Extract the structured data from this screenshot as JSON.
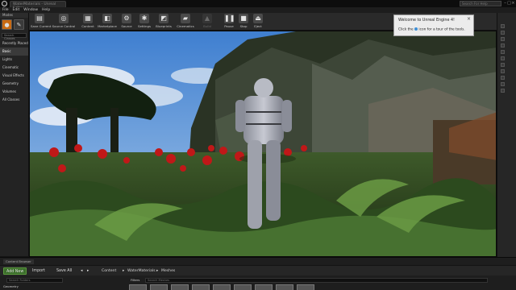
{
  "window": {
    "tab_title": "WaterMaterials - Unreal Editor",
    "search_placeholder": "Search For Help"
  },
  "menu": [
    "File",
    "Edit",
    "Window",
    "Help"
  ],
  "modes": {
    "header": "Modes",
    "search_placeholder": "Search Classes",
    "categories": [
      "Recently Placed",
      "Basic",
      "Lights",
      "Cinematic",
      "Visual Effects",
      "Geometry",
      "Volumes",
      "All Classes"
    ],
    "active": "Basic"
  },
  "toolbar": {
    "save_current": "Save Current",
    "source_control": "Source Control",
    "content": "Content",
    "marketplace": "Marketplace",
    "source": "Source",
    "settings": "Settings",
    "blueprints": "Blueprints",
    "cinematics": "Cinematics",
    "build": "Build",
    "pause": "Pause",
    "stop": "Stop",
    "eject": "Eject"
  },
  "tooltip": {
    "title": "Welcome to Unreal Engine 4!",
    "body_prefix": "Click the",
    "body_suffix": "icon for a tour of the tools."
  },
  "content_browser": {
    "tab": "Content Browser",
    "add_new": "Add New",
    "import": "Import",
    "save_all": "Save All",
    "path": [
      "Content",
      "WaterMaterials",
      "Meshes"
    ],
    "filters": "Filters",
    "folder_search_placeholder": "Search Folders",
    "asset_search_placeholder": "Search Meshes",
    "folder_item": "Geometry"
  },
  "colors": {
    "accent": "#c96a12",
    "add_new_green": "#3c6e2c",
    "tooltip_bg": "#ececec",
    "flower_red": "#c01818"
  }
}
